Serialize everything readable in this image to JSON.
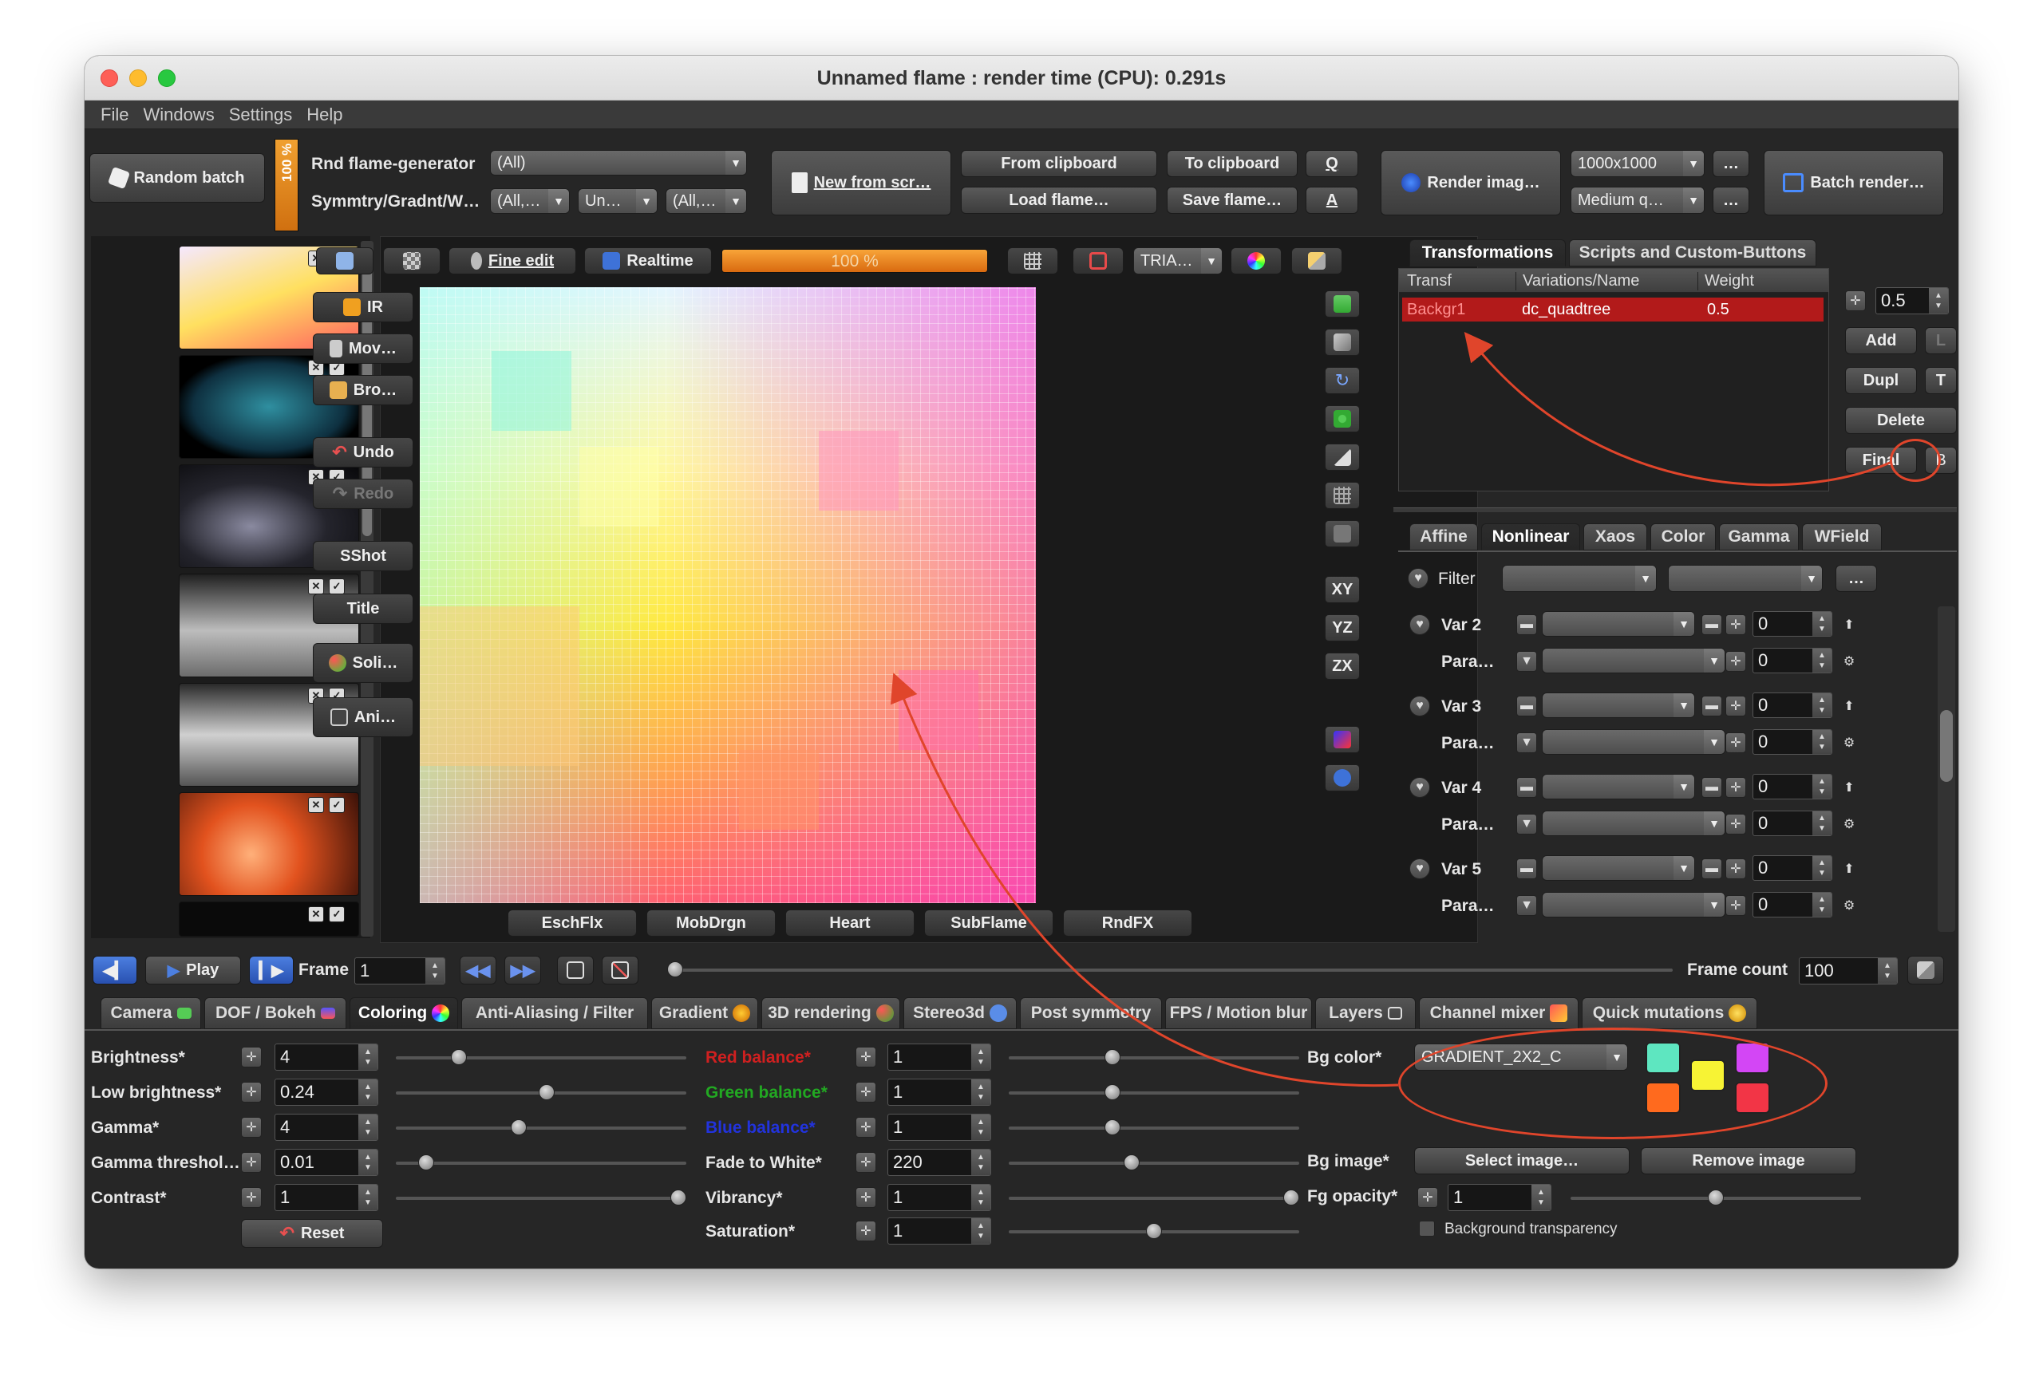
{
  "window": {
    "title": "Unnamed flame : render time (CPU): 0.291s"
  },
  "menu": [
    "File",
    "Windows",
    "Settings",
    "Help"
  ],
  "toolbar": {
    "random_batch": "Random batch",
    "progress_vertical": "100 %",
    "rnd_flame_generator_label": "Rnd flame-generator",
    "rnd_flame_generator_value": "(All)",
    "symmetry_label": "Symmtry/Gradnt/W…",
    "symmetry_value": "(All,…",
    "gradient_value": "Un…",
    "weight_value": "(All,…",
    "new_from_script": "New from scr…",
    "from_clipboard": "From clipboard",
    "to_clipboard": "To clipboard",
    "q_button": "Q",
    "load_flame": "Load flame…",
    "save_flame": "Save flame…",
    "a_button": "A",
    "render_image": "Render imag…",
    "resolution": "1000x1000",
    "quality": "Medium q…",
    "dash1": "…",
    "dash2": "…",
    "batch_render": "Batch render…"
  },
  "preview_toolbar": {
    "fine_edit": "Fine edit",
    "realtime": "Realtime",
    "progress": "100 %",
    "progress_value": 1.0,
    "tria": "TRIA…"
  },
  "left_tools": [
    "IR",
    "Mov…",
    "Bro…",
    "Undo",
    "Redo",
    "SShot",
    "Title",
    "Soli…",
    "Ani…"
  ],
  "right_tools": {
    "xy": "XY",
    "yz": "YZ",
    "zx": "ZX"
  },
  "bottom_variations": [
    "EschFlx",
    "MobDrgn",
    "Heart",
    "SubFlame",
    "RndFX"
  ],
  "playback": {
    "play": "Play",
    "frame_label": "Frame",
    "frame_value": "1",
    "frame_count_label": "Frame count",
    "frame_count_value": "100"
  },
  "main_tabs": [
    "Camera",
    "DOF / Bokeh",
    "Coloring",
    "Anti-Aliasing / Filter",
    "Gradient",
    "3D rendering",
    "Stereo3d",
    "Post symmetry",
    "FPS / Motion blur",
    "Layers",
    "Channel mixer",
    "Quick mutations"
  ],
  "coloring": {
    "brightness": {
      "label": "Brightness*",
      "value": "4",
      "level": 0.2
    },
    "low_brightness": {
      "label": "Low brightness*",
      "value": "0.24",
      "level": 0.52
    },
    "gamma": {
      "label": "Gamma*",
      "value": "4",
      "level": 0.42
    },
    "gamma_threshold": {
      "label": "Gamma threshol…",
      "value": "0.01",
      "level": 0.08
    },
    "contrast": {
      "label": "Contrast*",
      "value": "1",
      "level": 1.0
    },
    "reset": "Reset",
    "red_balance": {
      "label": "Red balance*",
      "value": "1",
      "level": 0.35
    },
    "green_balance": {
      "label": "Green balance*",
      "value": "1",
      "level": 0.35
    },
    "blue_balance": {
      "label": "Blue balance*",
      "value": "1",
      "level": 0.35
    },
    "fade_to_white": {
      "label": "Fade to White*",
      "value": "220",
      "level": 0.42
    },
    "vibrancy": {
      "label": "Vibrancy*",
      "value": "1",
      "level": 1.0
    },
    "saturation": {
      "label": "Saturation*",
      "value": "1",
      "level": 0.5
    },
    "bg_color_label": "Bg color*",
    "bg_color_value": "GRADIENT_2X2_C",
    "bg_image_label": "Bg image*",
    "select_image": "Select image…",
    "remove_image": "Remove image",
    "fg_opacity": {
      "label": "Fg opacity*",
      "value": "1",
      "level": 0.5
    },
    "bg_transparency": "Background transparency",
    "swatches": [
      "#5ee6c0",
      "#ff6a1e",
      "#f7f334",
      "#d346f5",
      "#f23546"
    ],
    "label_colors": {
      "red": "#d02020",
      "green": "#22a822",
      "blue": "#2233dd"
    }
  },
  "transform_panel": {
    "tabs": [
      "Transformations",
      "Scripts and Custom-Buttons"
    ],
    "columns": [
      "Transf",
      "Variations/Name",
      "Weight"
    ],
    "rows": [
      {
        "transf": "Backgr1",
        "variation": "dc_quadtree",
        "weight": "0.5"
      }
    ],
    "weight_spinner": "0.5",
    "add": "Add",
    "l": "L",
    "dupl": "Dupl",
    "t": "T",
    "delete": "Delete",
    "final": "Final",
    "b": "B"
  },
  "nonlinear": {
    "tabs": [
      "Affine",
      "Nonlinear",
      "Xaos",
      "Color",
      "Gamma",
      "WField"
    ],
    "filter_label": "Filter",
    "filter_more": "…",
    "vars": [
      {
        "var": "Var 2",
        "para": "Para…",
        "value": "0",
        "pvalue": "0"
      },
      {
        "var": "Var 3",
        "para": "Para…",
        "value": "0",
        "pvalue": "0"
      },
      {
        "var": "Var 4",
        "para": "Para…",
        "value": "0",
        "pvalue": "0"
      },
      {
        "var": "Var 5",
        "para": "Para…",
        "value": "0",
        "pvalue": "0"
      }
    ]
  }
}
